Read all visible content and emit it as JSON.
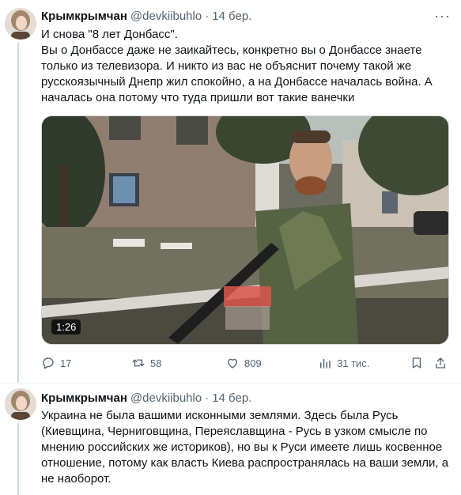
{
  "tweets": [
    {
      "name": "Крымкрымчан",
      "handle": "@devkiibuhlo",
      "dot": "·",
      "time": "14 бер.",
      "lines": [
        "И снова \"8 лет Донбасс\".",
        "Вы о Донбассе даже не заикайтесь, конкретно вы о Донбассе знаете",
        "только из телевизора. И никто из вас не объяснит почему такой же",
        "русскоязычный Днепр жил спокойно, а на Донбассе началась война. А",
        "началась она потому что туда пришли вот такие ванечки"
      ],
      "video": {
        "duration": "1:26"
      },
      "actions": {
        "replies": "17",
        "retweets": "58",
        "likes": "809",
        "views": "31 тис."
      }
    },
    {
      "name": "Крымкрымчан",
      "handle": "@devkiibuhlo",
      "dot": "·",
      "time": "14 бер.",
      "lines": [
        "Украина не была вашими исконными землями. Здесь была Русь",
        "(Киевщина, Черниговщина, Переяславщина - Русь в узком смысле по",
        "мнению российских же историков), но вы к Руси имеете лишь косвенное",
        "отношение, потому как власть Киева распространялась на ваши земли, а",
        "не наоборот."
      ]
    }
  ],
  "colors": {
    "text": "#0f1419",
    "secondary": "#536471",
    "border": "#eff3f4"
  },
  "icons": [
    "more-icon",
    "reply-icon",
    "retweet-icon",
    "like-icon",
    "views-icon",
    "share-icon"
  ]
}
